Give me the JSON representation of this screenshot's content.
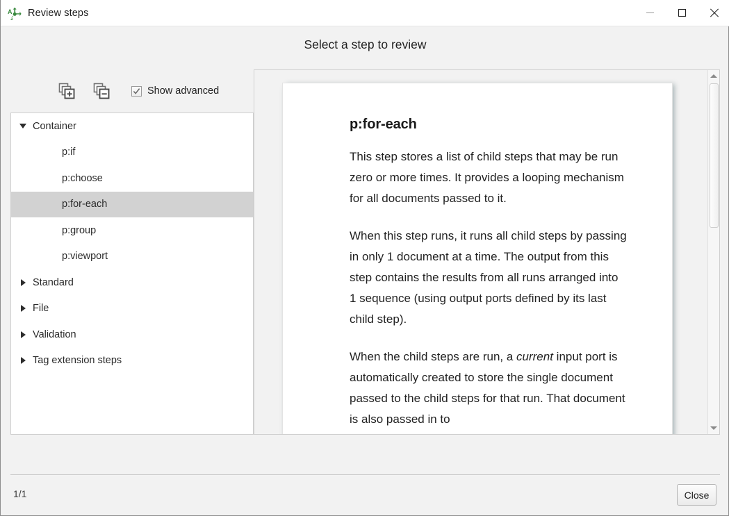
{
  "window": {
    "title": "Review steps",
    "icon": "workflow-steps-icon",
    "accent": "#3a8a3f",
    "controls": {
      "minimize": "minimize-icon",
      "maximize": "maximize-icon",
      "close": "close-icon"
    }
  },
  "header": {
    "caption": "Select a step to review"
  },
  "toolbar": {
    "expand_all": "expand-all-icon",
    "collapse_all": "collapse-all-icon",
    "show_advanced_label": "Show advanced",
    "show_advanced_checked": true
  },
  "tree": {
    "selected": "p:for-each",
    "rows": [
      {
        "label": "Container",
        "level": 0,
        "expanded": true,
        "has_children": true,
        "selected": false
      },
      {
        "label": "p:if",
        "level": 1,
        "expanded": false,
        "has_children": false,
        "selected": false
      },
      {
        "label": "p:choose",
        "level": 1,
        "expanded": false,
        "has_children": false,
        "selected": false
      },
      {
        "label": "p:for-each",
        "level": 1,
        "expanded": false,
        "has_children": false,
        "selected": true
      },
      {
        "label": "p:group",
        "level": 1,
        "expanded": false,
        "has_children": false,
        "selected": false
      },
      {
        "label": "p:viewport",
        "level": 1,
        "expanded": false,
        "has_children": false,
        "selected": false
      },
      {
        "label": "Standard",
        "level": 0,
        "expanded": false,
        "has_children": true,
        "selected": false
      },
      {
        "label": "File",
        "level": 0,
        "expanded": false,
        "has_children": true,
        "selected": false
      },
      {
        "label": "Validation",
        "level": 0,
        "expanded": false,
        "has_children": true,
        "selected": false
      },
      {
        "label": "Tag extension steps",
        "level": 0,
        "expanded": false,
        "has_children": true,
        "selected": false
      }
    ]
  },
  "preview": {
    "doc_title": "p:for-each",
    "paragraphs": [
      "This step stores a list of child steps that may be run zero or more times. It provides a looping mechanism for all documents passed to it.",
      "When this step runs, it runs all child steps by passing in only 1 document at a time. The output from this step contains the results from all runs arranged into 1 sequence (using output ports defined by its last child step).",
      "When the child steps are run, a current input port is automatically created to store the single document passed to the child steps for that run. That document is also passed in to"
    ],
    "paragraph3_parts": {
      "before": "When the child steps are run, a ",
      "emphasis": "current",
      "after": " input port is automatically created to store the single document passed to the child steps for that run. That document is also passed in to"
    },
    "scrollbar": {
      "up_icon": "scroll-up-icon",
      "down_icon": "scroll-down-icon"
    }
  },
  "footer": {
    "page_indicator": "1/1",
    "close_label": "Close"
  }
}
